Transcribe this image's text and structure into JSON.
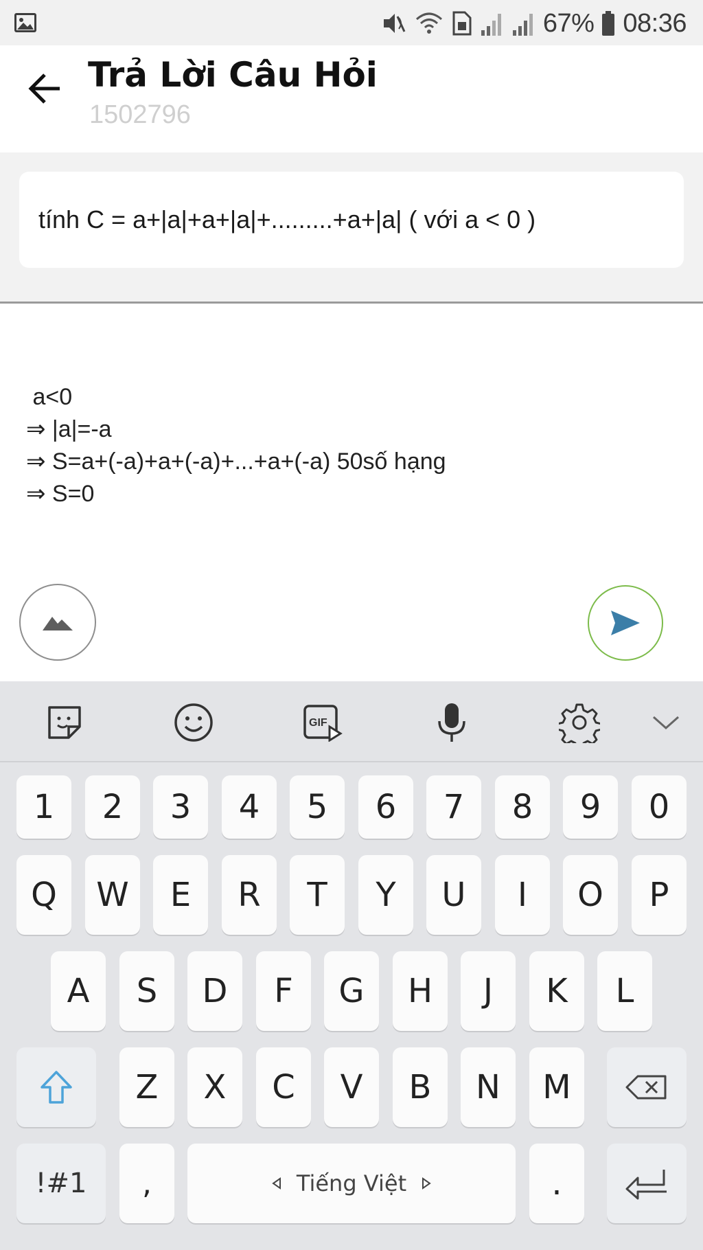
{
  "status_bar": {
    "battery_percent": "67%",
    "time": "08:36"
  },
  "header": {
    "title": "Trả Lời Câu Hỏi",
    "subtitle": "1502796"
  },
  "question": {
    "text": "tính C = a+|a|+a+|a|+.........+a+|a| ( với a < 0  )"
  },
  "answer": {
    "lines": [
      " a<0",
      "⇒ |a|=-a",
      "⇒ S=a+(-a)+a+(-a)+...+a+(-a) 50số hạng",
      "⇒ S=0"
    ]
  },
  "keyboard": {
    "row_numbers": [
      "1",
      "2",
      "3",
      "4",
      "5",
      "6",
      "7",
      "8",
      "9",
      "0"
    ],
    "row_q": [
      "Q",
      "W",
      "E",
      "R",
      "T",
      "Y",
      "U",
      "I",
      "O",
      "P"
    ],
    "row_a": [
      "A",
      "S",
      "D",
      "F",
      "G",
      "H",
      "J",
      "K",
      "L"
    ],
    "row_z": [
      "Z",
      "X",
      "C",
      "V",
      "B",
      "N",
      "M"
    ],
    "symbols_label": "!#1",
    "comma_label": ",",
    "space_label": "Tiếng Việt",
    "period_label": "."
  },
  "colors": {
    "send_accent": "#3b7ea8",
    "send_border": "#7cbb4a",
    "shift_accent": "#4da3d9"
  }
}
